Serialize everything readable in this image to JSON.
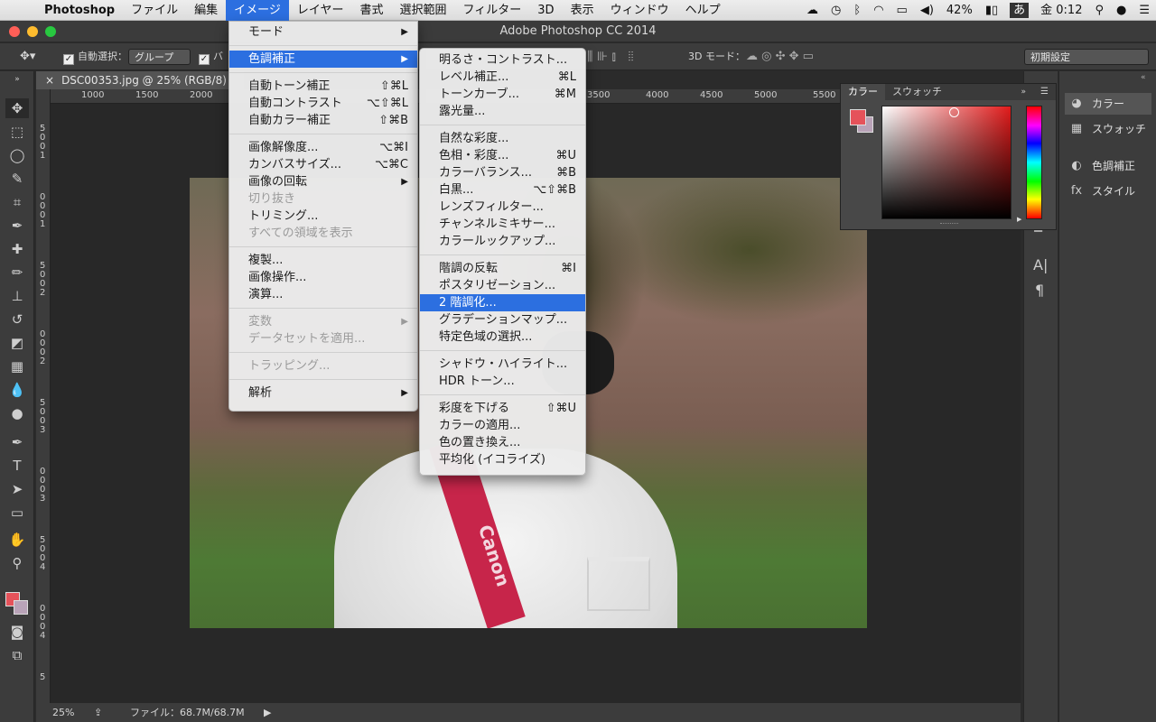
{
  "menubar": {
    "apple": "",
    "app_name": "Photoshop",
    "items": [
      "ファイル",
      "編集",
      "イメージ",
      "レイヤー",
      "書式",
      "選択範囲",
      "フィルター",
      "3D",
      "表示",
      "ウィンドウ",
      "ヘルプ"
    ],
    "active_index": 2,
    "battery": "42%",
    "input_method": "あ",
    "clock": "金 0:12"
  },
  "window": {
    "title": "Adobe Photoshop CC 2014"
  },
  "options_bar": {
    "auto_select_label": "自動選択：",
    "auto_select_value": "グループ",
    "transform_label": "バ",
    "mode_3d_label": "3D モード：",
    "workspace": "初期設定"
  },
  "document": {
    "tab_title": "DSC00353.jpg @ 25% (RGB/8)",
    "ruler_h": [
      "1000",
      "1500",
      "2000",
      "3500",
      "4000",
      "4500",
      "5000",
      "5500"
    ],
    "ruler_v": [
      "5",
      "0",
      "0",
      "1",
      "0",
      "0",
      "0",
      "1",
      "5",
      "0",
      "0",
      "2",
      "0",
      "0",
      "0",
      "2",
      "5",
      "0",
      "0",
      "3",
      "0",
      "0",
      "0",
      "3",
      "5",
      "0",
      "0",
      "4",
      "0",
      "0",
      "0",
      "4",
      "5"
    ],
    "strap_text": "Canon"
  },
  "statusbar": {
    "zoom": "25%",
    "file_info": "ファイル：68.7M/68.7M"
  },
  "image_menu": [
    {
      "label": "モード",
      "sub": true
    },
    {
      "sep": true
    },
    {
      "label": "色調補正",
      "sub": true,
      "hl": true
    },
    {
      "sep": true
    },
    {
      "label": "自動トーン補正",
      "sc": "⇧⌘L"
    },
    {
      "label": "自動コントラスト",
      "sc": "⌥⇧⌘L"
    },
    {
      "label": "自動カラー補正",
      "sc": "⇧⌘B"
    },
    {
      "sep": true
    },
    {
      "label": "画像解像度...",
      "sc": "⌥⌘I"
    },
    {
      "label": "カンバスサイズ...",
      "sc": "⌥⌘C"
    },
    {
      "label": "画像の回転",
      "sub": true
    },
    {
      "label": "切り抜き",
      "dis": true
    },
    {
      "label": "トリミング..."
    },
    {
      "label": "すべての領域を表示",
      "dis": true
    },
    {
      "sep": true
    },
    {
      "label": "複製..."
    },
    {
      "label": "画像操作..."
    },
    {
      "label": "演算..."
    },
    {
      "sep": true
    },
    {
      "label": "変数",
      "sub": true,
      "dis": true
    },
    {
      "label": "データセットを適用...",
      "dis": true
    },
    {
      "sep": true
    },
    {
      "label": "トラッピング...",
      "dis": true
    },
    {
      "sep": true
    },
    {
      "label": "解析",
      "sub": true
    }
  ],
  "adjust_menu": [
    {
      "label": "明るさ・コントラスト..."
    },
    {
      "label": "レベル補正...",
      "sc": "⌘L"
    },
    {
      "label": "トーンカーブ...",
      "sc": "⌘M"
    },
    {
      "label": "露光量..."
    },
    {
      "sep": true
    },
    {
      "label": "自然な彩度..."
    },
    {
      "label": "色相・彩度...",
      "sc": "⌘U"
    },
    {
      "label": "カラーバランス...",
      "sc": "⌘B"
    },
    {
      "label": "白黒...",
      "sc": "⌥⇧⌘B"
    },
    {
      "label": "レンズフィルター..."
    },
    {
      "label": "チャンネルミキサー..."
    },
    {
      "label": "カラールックアップ..."
    },
    {
      "sep": true
    },
    {
      "label": "階調の反転",
      "sc": "⌘I"
    },
    {
      "label": "ポスタリゼーション..."
    },
    {
      "label": "2 階調化...",
      "hl": true
    },
    {
      "label": "グラデーションマップ..."
    },
    {
      "label": "特定色域の選択..."
    },
    {
      "sep": true
    },
    {
      "label": "シャドウ・ハイライト..."
    },
    {
      "label": "HDR トーン..."
    },
    {
      "sep": true
    },
    {
      "label": "彩度を下げる",
      "sc": "⇧⌘U"
    },
    {
      "label": "カラーの適用..."
    },
    {
      "label": "色の置き換え..."
    },
    {
      "label": "平均化 (イコライズ)"
    }
  ],
  "color_panel": {
    "tabs": [
      "カラー",
      "スウォッチ"
    ],
    "fg": "#e5525a",
    "bg": "#b9a3b8"
  },
  "right_panel": [
    "カラー",
    "スウォッチ",
    "色調補正",
    "スタイル"
  ],
  "colors": {
    "accent": "#2c6fe0",
    "foreground": "#e5525a"
  }
}
